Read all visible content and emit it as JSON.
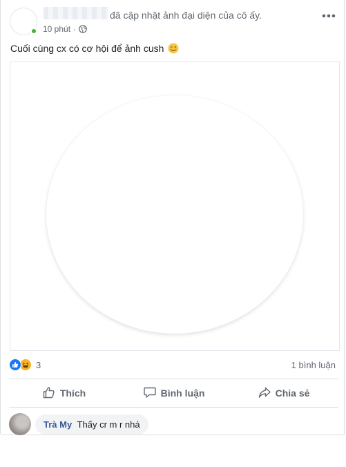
{
  "header": {
    "action_text": "đã cập nhật ảnh đại diện của cô ấy.",
    "timestamp": "10 phút",
    "separator": "·",
    "privacy_icon": "globe-icon",
    "more_icon": "more-options-icon"
  },
  "post": {
    "caption": "Cuối cùng cx có cơ hội để ảnh cush",
    "caption_emoji": "smiling-face-emoji"
  },
  "stats": {
    "reaction_icons": [
      "like-reaction-icon",
      "haha-reaction-icon"
    ],
    "reaction_count": "3",
    "comment_count": "1 bình luận"
  },
  "actions": {
    "like_label": "Thích",
    "comment_label": "Bình luận",
    "share_label": "Chia sẻ"
  },
  "comment": {
    "author": "Trà My",
    "text": "Thấy cr m r nhá"
  },
  "colors": {
    "online": "#42b72a",
    "like_reaction": "#1877f2",
    "haha_reaction": "#f7b125",
    "author_link": "#385898",
    "secondary_text": "#606770"
  }
}
